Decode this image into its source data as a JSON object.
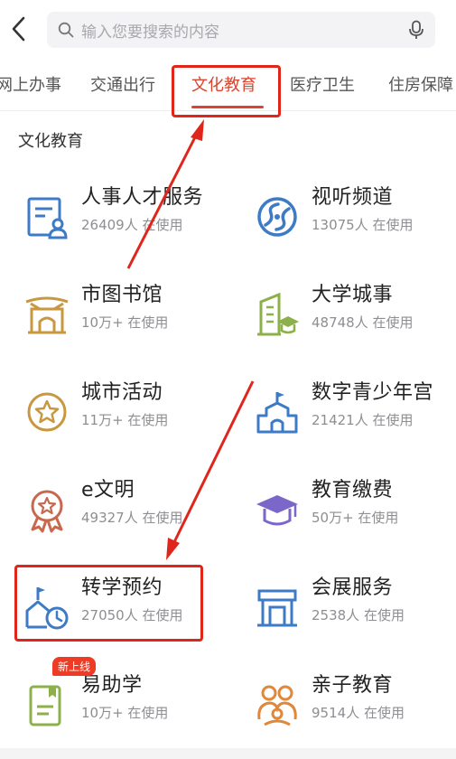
{
  "header": {
    "search_placeholder": "输入您要搜索的内容"
  },
  "tabs": [
    {
      "label": "网上办事",
      "active": false
    },
    {
      "label": "交通出行",
      "active": false
    },
    {
      "label": "文化教育",
      "active": true
    },
    {
      "label": "医疗卫生",
      "active": false
    },
    {
      "label": "住房保障",
      "active": false
    }
  ],
  "section": {
    "title": "文化教育",
    "items": [
      {
        "name": "人事人才服务",
        "count": "26409人 在使用",
        "icon": "personnel-icon"
      },
      {
        "name": "视听频道",
        "count": "13075人 在使用",
        "icon": "film-reel-icon"
      },
      {
        "name": "市图书馆",
        "count": "10万+ 在使用",
        "icon": "library-icon"
      },
      {
        "name": "大学城事",
        "count": "48748人 在使用",
        "icon": "university-icon"
      },
      {
        "name": "城市活动",
        "count": "11万+ 在使用",
        "icon": "star-badge-icon"
      },
      {
        "name": "数字青少年宫",
        "count": "21421人 在使用",
        "icon": "palace-icon"
      },
      {
        "name": "e文明",
        "count": "49327人 在使用",
        "icon": "medal-icon"
      },
      {
        "name": "教育缴费",
        "count": "50万+ 在使用",
        "icon": "graduation-cap-icon"
      },
      {
        "name": "转学预约",
        "count": "27050人 在使用",
        "icon": "school-clock-icon"
      },
      {
        "name": "会展服务",
        "count": "2538人 在使用",
        "icon": "exhibition-icon"
      },
      {
        "name": "易助学",
        "count": "10万+ 在使用",
        "icon": "student-aid-icon",
        "badge": "新上线"
      },
      {
        "name": "亲子教育",
        "count": "9514人 在使用",
        "icon": "parent-child-icon"
      }
    ]
  },
  "colors": {
    "accent": "#d9452f",
    "annotation": "#e0261a",
    "icon_blue": "#3d7bc6",
    "icon_gold": "#c8973f",
    "icon_green": "#8cb04a",
    "icon_orange": "#e0873a"
  }
}
